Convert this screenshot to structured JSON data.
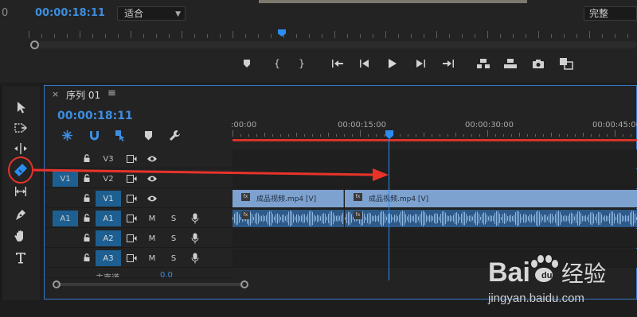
{
  "monitor": {
    "left_number": "0",
    "timecode": "00:00:18:11",
    "fit_select": "适合",
    "quality_select": "完整"
  },
  "transport": {
    "buttons": [
      "marker",
      "mark-in",
      "mark-out",
      "go-to-in",
      "step-back",
      "play",
      "step-forward",
      "go-to-out",
      "lift",
      "extract",
      "export-frame",
      "comparison-view"
    ]
  },
  "tools": [
    "selection",
    "track-select-forward",
    "ripple-edit",
    "razor",
    "slip",
    "pen",
    "hand",
    "type"
  ],
  "timeline": {
    "tab_close": "×",
    "sequence_name": "序列 01",
    "menu_glyph": "≡",
    "timecode": "00:00:18:11",
    "ruler_labels": [
      ":00:00",
      "00:00:15:00",
      "00:00:30:00",
      "00:00:45:00"
    ],
    "video_tracks": [
      {
        "source": "",
        "name": "V3"
      },
      {
        "source": "V1",
        "name": "V2"
      },
      {
        "source": "",
        "name": "V1"
      }
    ],
    "audio_tracks": [
      {
        "source": "A1",
        "name": "A1",
        "mute": "M",
        "solo": "S"
      },
      {
        "source": "",
        "name": "A2",
        "mute": "M",
        "solo": "S"
      },
      {
        "source": "",
        "name": "A3",
        "mute": "M",
        "solo": "S"
      }
    ],
    "clips": [
      {
        "name": "成品视频.mp4 [V]"
      },
      {
        "name": "成品视频.mp4 [V]"
      }
    ],
    "fx_badge": "fx",
    "master_partial": "主声道",
    "master_value": "0.0"
  },
  "watermark": {
    "logo_text": "Bai经验",
    "url": "jingyan.baidu.com"
  },
  "colors": {
    "accent_blue": "#3d8ee0",
    "playhead": "#2d8cf0",
    "annotation_red": "#e8332a",
    "video_clip": "#7ea2cf",
    "audio_clip": "#2e5a8a"
  }
}
